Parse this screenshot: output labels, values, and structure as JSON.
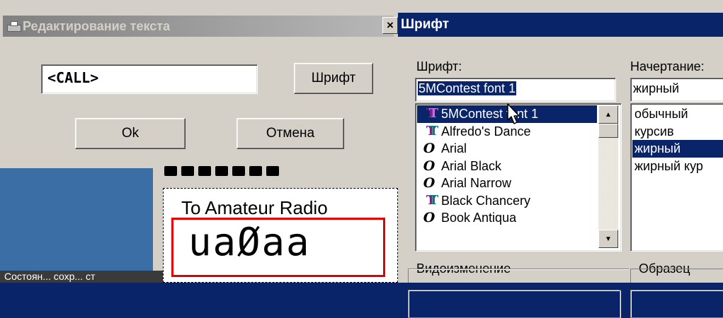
{
  "edit_dialog": {
    "title": "Редактирование текста",
    "close_glyph": "×",
    "input_value": "<CALL>",
    "font_button": "Шрифт",
    "ok_button": "Ok",
    "cancel_button": "Отмена"
  },
  "font_dialog": {
    "title": "Шрифт",
    "font_label": "Шрифт:",
    "font_value": "5MContest font 1",
    "style_label": "Начертание:",
    "style_value": "жирный",
    "fonts": [
      {
        "name": "5MContest font 1",
        "icon": "truetype-icon",
        "selected": true
      },
      {
        "name": "Alfredo's Dance",
        "icon": "truetype-icon",
        "selected": false
      },
      {
        "name": "Arial",
        "icon": "opentype-icon",
        "selected": false
      },
      {
        "name": "Arial Black",
        "icon": "opentype-icon",
        "selected": false
      },
      {
        "name": "Arial Narrow",
        "icon": "opentype-icon",
        "selected": false
      },
      {
        "name": "Black Chancery",
        "icon": "truetype-icon",
        "selected": false
      },
      {
        "name": "Book Antiqua",
        "icon": "opentype-icon",
        "selected": false
      }
    ],
    "styles": [
      {
        "name": "обычный",
        "selected": false
      },
      {
        "name": "курсив",
        "selected": false
      },
      {
        "name": "жирный",
        "selected": true
      },
      {
        "name": "жирный кур",
        "selected": false
      }
    ],
    "effects_group": "Видоизменение",
    "sample_group": "Образец"
  },
  "editor": {
    "award_title": "To Amateur Radio",
    "call_display": "uaØaa",
    "status_text": "Состоян... сохр... ст"
  },
  "colors": {
    "selection": "#0a246a",
    "frame_red": "#e00000",
    "face": "#d4d0c8"
  }
}
